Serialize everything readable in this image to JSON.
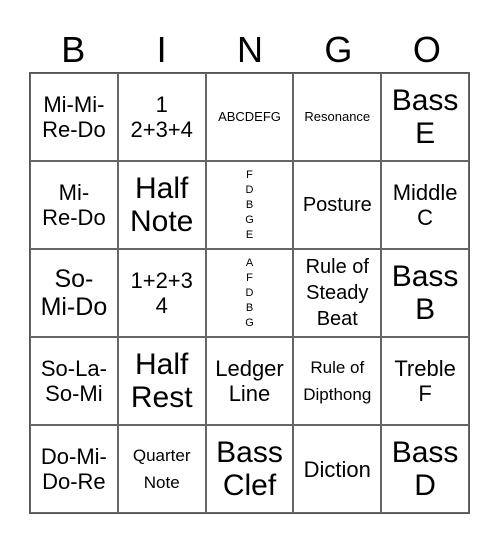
{
  "title_letters": [
    "B",
    "I",
    "N",
    "G",
    "O"
  ],
  "cells": [
    [
      {
        "text": "Mi-Mi-\nRe-Do",
        "size": "m"
      },
      {
        "text": "1\n2+3+4",
        "size": "m"
      },
      {
        "text": "ABCDEFG",
        "size": "xs"
      },
      {
        "text": "Resonance",
        "size": "xs"
      },
      {
        "text": "Bass\nE",
        "size": "xl"
      }
    ],
    [
      {
        "text": "Mi-\nRe-Do",
        "size": "m"
      },
      {
        "text": "Half\nNote",
        "size": "xl"
      },
      {
        "text": "F\nD\nB\nG\nE",
        "size": "xxs"
      },
      {
        "text": "Posture",
        "size": "ms"
      },
      {
        "text": "Middle\nC",
        "size": "m"
      }
    ],
    [
      {
        "text": "So-\nMi-Do",
        "size": "l"
      },
      {
        "text": "1+2+3\n4",
        "size": "m"
      },
      {
        "text": "A\nF\nD\nB\nG",
        "size": "xxs"
      },
      {
        "text": "Rule of\nSteady\nBeat",
        "size": "ms"
      },
      {
        "text": "Bass\nB",
        "size": "xl"
      }
    ],
    [
      {
        "text": "So-La-\nSo-Mi",
        "size": "m"
      },
      {
        "text": "Half\nRest",
        "size": "xl"
      },
      {
        "text": "Ledger\nLine",
        "size": "m"
      },
      {
        "text": "Rule of\nDipthong",
        "size": "s"
      },
      {
        "text": "Treble\nF",
        "size": "m"
      }
    ],
    [
      {
        "text": "Do-Mi-\nDo-Re",
        "size": "m"
      },
      {
        "text": "Quarter\nNote",
        "size": "s"
      },
      {
        "text": "Bass\nClef",
        "size": "xl"
      },
      {
        "text": "Diction",
        "size": "m"
      },
      {
        "text": "Bass\nD",
        "size": "xl"
      }
    ]
  ]
}
